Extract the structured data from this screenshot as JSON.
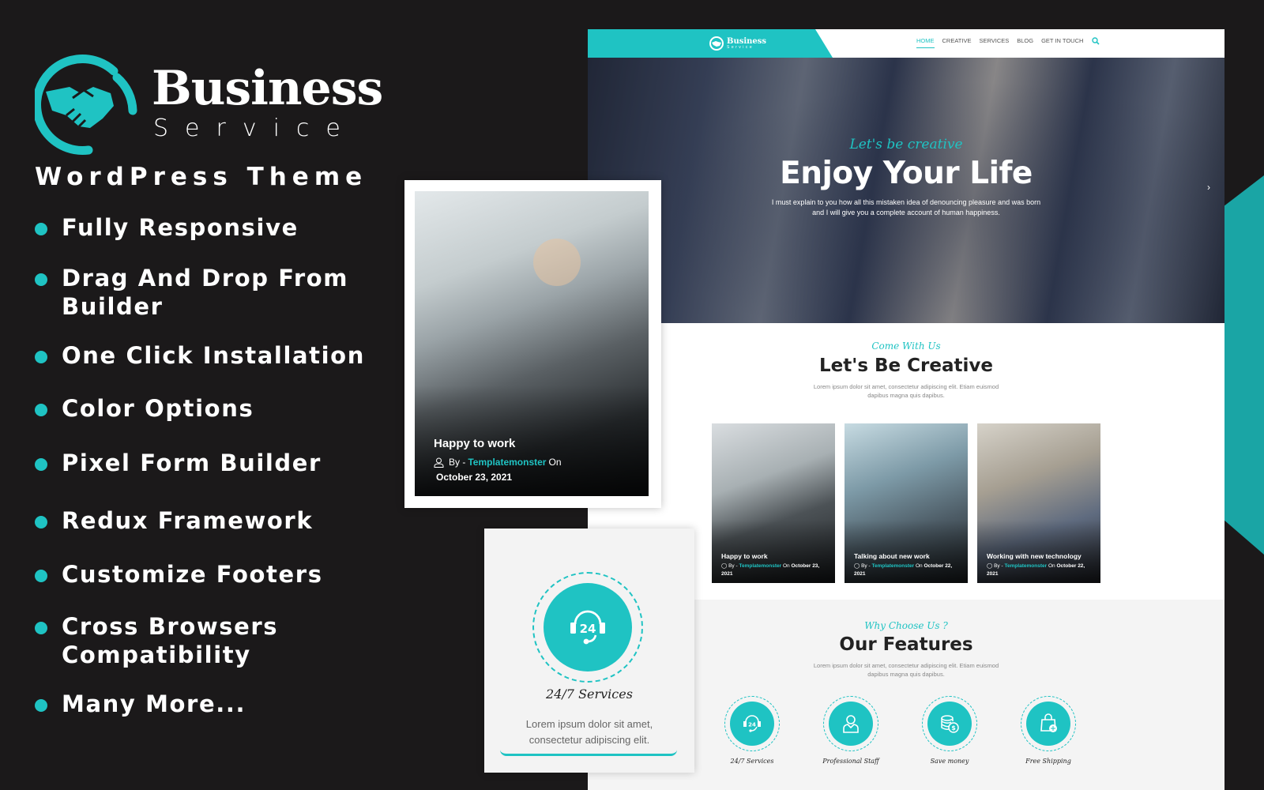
{
  "promo": {
    "brand_name": "Business",
    "brand_sub": "Service",
    "tagline": "WordPress Theme",
    "features": [
      "Fully Responsive",
      "Drag And Drop From Builder",
      "One Click Installation",
      "Color Options",
      "Pixel Form Builder",
      "Redux Framework",
      "Customize Footers",
      "Cross Browsers Compatibility",
      "Many More..."
    ]
  },
  "colors": {
    "accent": "#1fc3c3",
    "background": "#1b191a",
    "side_accent": "#1aa5a5"
  },
  "site": {
    "logo_name": "Business",
    "logo_sub": "Service",
    "nav": [
      "HOME",
      "CREATIVE",
      "SERVICES",
      "BLOG",
      "GET IN TOUCH"
    ],
    "nav_active": "HOME",
    "search_icon": "search-icon",
    "hero": {
      "script": "Let's be creative",
      "title": "Enjoy Your Life",
      "description": "I must explain to you how all this mistaken idea of denouncing pleasure and was born and I will give you a complete account of human happiness.",
      "next_icon": "chevron-right-icon"
    },
    "creative": {
      "script": "Come With Us",
      "title": "Let's Be Creative",
      "description": "Lorem ipsum dolor sit amet, consectetur adipiscing elit. Etiam euismod dapibus magna quis dapibus."
    },
    "posts": [
      {
        "title": "Happy to work",
        "by": "By -",
        "author": "Templatemonster",
        "on": "On",
        "date": "October 23, 2021"
      },
      {
        "title": "Talking about new work",
        "by": "By -",
        "author": "Templatemonster",
        "on": "On",
        "date": "October 22, 2021"
      },
      {
        "title": "Working with new technology",
        "by": "By -",
        "author": "Templatemonster",
        "on": "On",
        "date": "October 22, 2021"
      }
    ],
    "features": {
      "script": "Why Choose Us ?",
      "title": "Our Features",
      "description": "Lorem ipsum dolor sit amet, consectetur adipiscing elit. Etiam euismod dapibus magna quis dapibus.",
      "items": [
        {
          "label": "24/7 Services",
          "icon": "headset-24-icon"
        },
        {
          "label": "Professional Staff",
          "icon": "staff-icon"
        },
        {
          "label": "Save money",
          "icon": "coins-icon"
        },
        {
          "label": "Free Shipping",
          "icon": "shopping-bag-icon"
        }
      ]
    }
  },
  "blog_card": {
    "title": "Happy to work",
    "by": "By -",
    "author": "Templatemonster",
    "on": "On",
    "date": "October 23, 2021"
  },
  "service_card": {
    "title": "24/7 Services",
    "description": "Lorem ipsum dolor sit amet, consectetur adipiscing elit."
  }
}
